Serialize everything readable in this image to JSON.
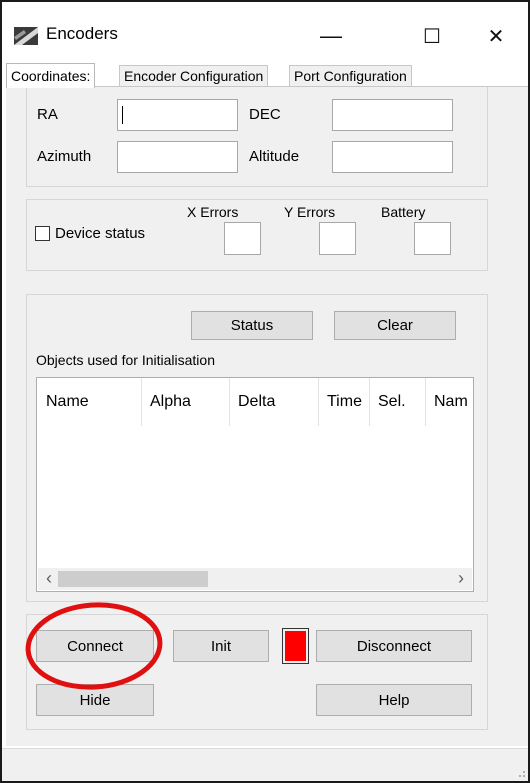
{
  "window": {
    "title": "Encoders",
    "minimize": "—",
    "maximize": "☐",
    "close": "✕"
  },
  "tabs": [
    {
      "label": "Coordinates:"
    },
    {
      "label": "Encoder Configuration"
    },
    {
      "label": "Port Configuration"
    }
  ],
  "coords": {
    "ra_label": "RA",
    "ra_value": "",
    "dec_label": "DEC",
    "dec_value": "",
    "azimuth_label": "Azimuth",
    "azimuth_value": "",
    "altitude_label": "Altitude",
    "altitude_value": ""
  },
  "device": {
    "status_label": "Device status",
    "status_checked": false,
    "x_errors_label": "X Errors",
    "y_errors_label": "Y Errors",
    "battery_label": "Battery"
  },
  "init_objects": {
    "status_button": "Status",
    "clear_button": "Clear",
    "caption": "Objects used for Initialisation",
    "columns": [
      "Name",
      "Alpha",
      "Delta",
      "Time",
      "Sel.",
      "Nam"
    ],
    "scroll_left": "‹",
    "scroll_right": "›"
  },
  "actions": {
    "connect": "Connect",
    "init": "Init",
    "disconnect": "Disconnect",
    "hide": "Hide",
    "help": "Help",
    "indicator_color": "#ff0000",
    "annotation_color": "#e01010"
  },
  "statusbar": {
    "text": ""
  }
}
